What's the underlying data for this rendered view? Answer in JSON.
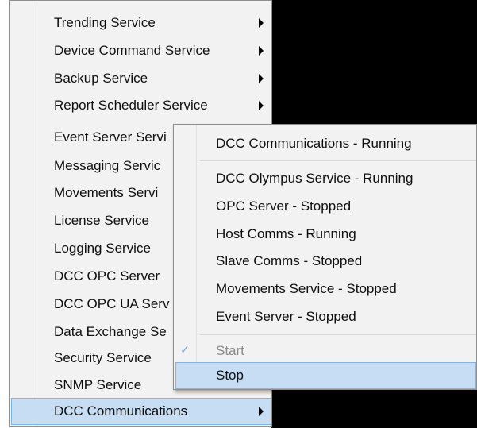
{
  "main_menu": {
    "items": [
      {
        "label": "Trending Service",
        "submenu": true
      },
      {
        "label": "Device Command Service",
        "submenu": true
      },
      {
        "label": "Backup Service",
        "submenu": true
      },
      {
        "label": "Report Scheduler Service",
        "submenu": true
      },
      {
        "label": "Event Server Servi",
        "submenu": true
      },
      {
        "label": "Messaging Servic",
        "submenu": true
      },
      {
        "label": "Movements Servi",
        "submenu": true
      },
      {
        "label": "License Service",
        "submenu": true
      },
      {
        "label": "Logging Service",
        "submenu": true
      },
      {
        "label": "DCC OPC Server",
        "submenu": true
      },
      {
        "label": "DCC OPC UA Serv",
        "submenu": true
      },
      {
        "label": "Data Exchange Se",
        "submenu": true
      },
      {
        "label": "Security Service",
        "submenu": true
      },
      {
        "label": "SNMP Service",
        "submenu": true
      },
      {
        "label": "DCC Communications",
        "submenu": true,
        "highlighted": true
      }
    ]
  },
  "submenu": {
    "header": "DCC Communications - Running",
    "services": [
      "DCC Olympus Service - Running",
      "OPC Server - Stopped",
      "Host Comms - Running",
      "Slave Comms - Stopped",
      "Movements Service - Stopped",
      "Event Server - Stopped"
    ],
    "start_label": "Start",
    "start_icon": "checkmark-icon",
    "start_enabled": false,
    "stop_label": "Stop",
    "stop_highlighted": true
  },
  "colors": {
    "menu_background": "#f2f2f2",
    "highlight_fill": "#c7ddf3",
    "highlight_border": "#7fb4e9",
    "disabled_text": "#8b8b8b",
    "desktop_background": "#000000"
  }
}
